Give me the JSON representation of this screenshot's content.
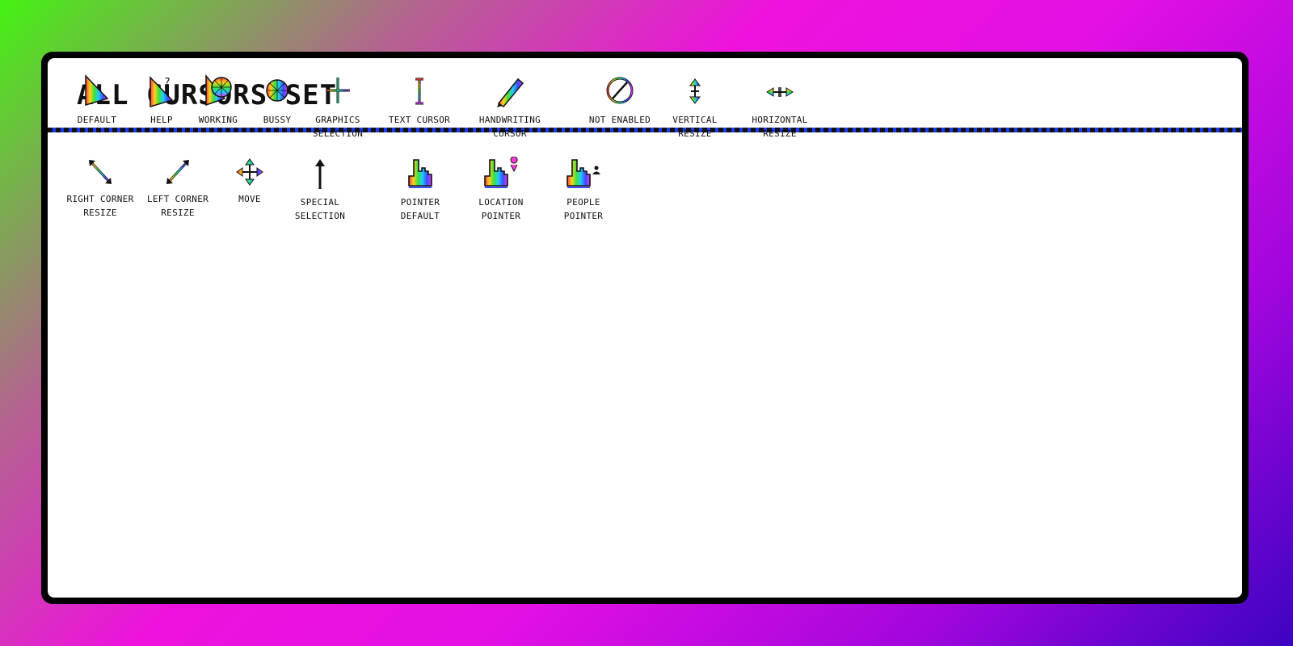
{
  "title": "ALL CURSORS SET",
  "cursors": [
    {
      "label": "DEFAULT",
      "icon": "default-arrow-icon"
    },
    {
      "label": "HELP",
      "icon": "help-arrow-icon"
    },
    {
      "label": "WORKING",
      "icon": "working-arrow-icon"
    },
    {
      "label": "BUSSY",
      "icon": "busy-ball-icon"
    },
    {
      "label": "GRAPHICS\nSELECTION",
      "icon": "crosshair-icon"
    },
    {
      "label": "TEXT CURSOR",
      "icon": "text-beam-icon"
    },
    {
      "label": "HANDWRITING\nCURSOR",
      "icon": "pen-icon"
    },
    {
      "label": "NOT ENABLED",
      "icon": "not-allowed-icon"
    },
    {
      "label": "VERTICAL\nRESIZE",
      "icon": "vertical-resize-icon"
    },
    {
      "label": "HORIZONTAL\nRESIZE",
      "icon": "horizontal-resize-icon"
    },
    {
      "label": "RIGHT CORNER\nRESIZE",
      "icon": "diagonal-resize-right-icon"
    },
    {
      "label": "LEFT CORNER\nRESIZE",
      "icon": "diagonal-resize-left-icon"
    },
    {
      "label": "MOVE",
      "icon": "move-arrows-icon"
    },
    {
      "label": "SPECIAL\nSELECTION",
      "icon": "up-arrow-icon"
    },
    {
      "label": "POINTER\nDEFAULT",
      "icon": "hand-pointer-icon"
    },
    {
      "label": "LOCATION\nPOINTER",
      "icon": "hand-location-icon"
    },
    {
      "label": "PEOPLE\nPOINTER",
      "icon": "hand-people-icon"
    }
  ]
}
